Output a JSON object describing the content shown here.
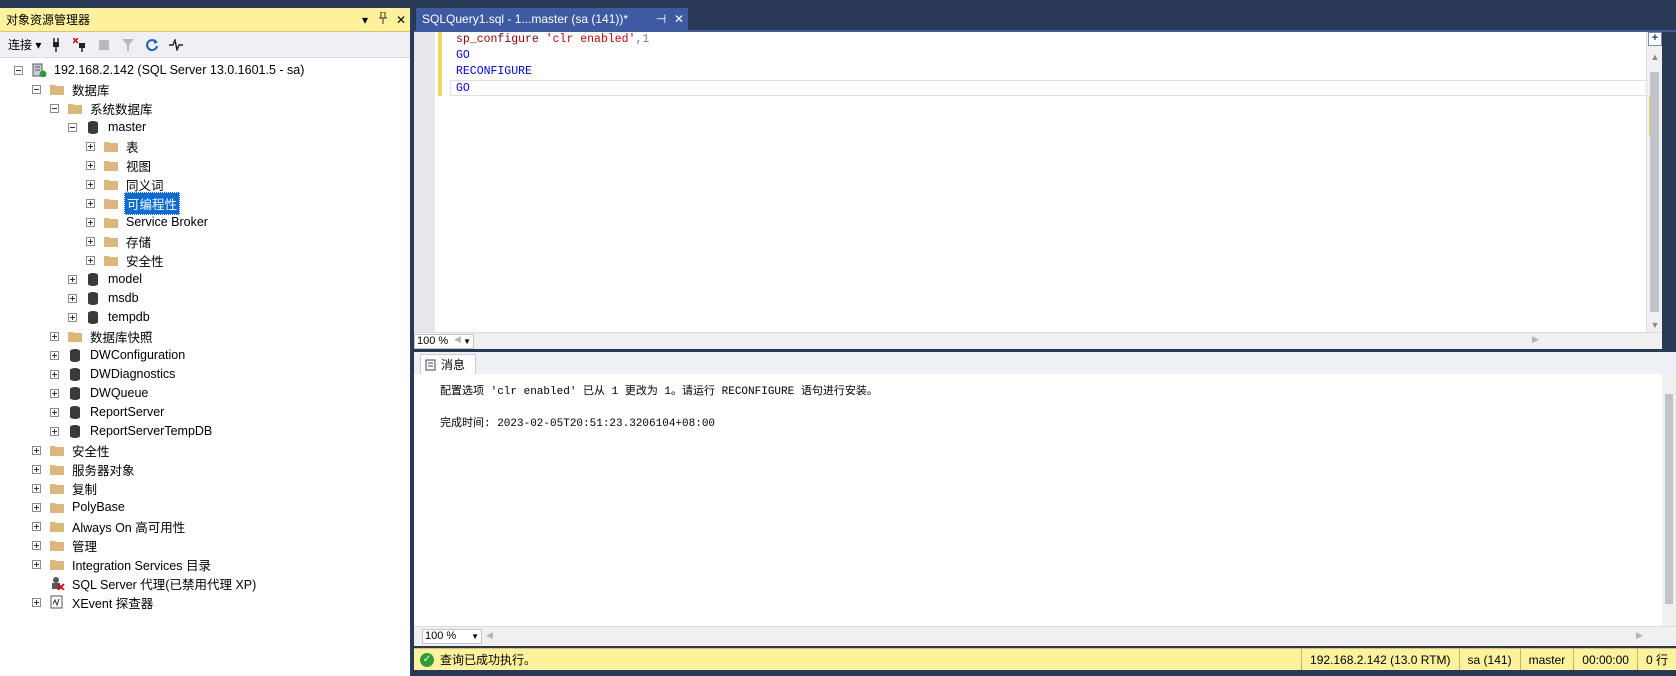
{
  "object_explorer": {
    "title": "对象资源管理器",
    "toolbar": {
      "connect_label": "连接"
    },
    "tree": [
      {
        "id": "server",
        "label": "192.168.2.142 (SQL Server 13.0.1601.5 - sa)",
        "icon": "server-icon"
      },
      {
        "id": "databases",
        "label": "数据库",
        "icon": "folder-icon"
      },
      {
        "id": "system-databases",
        "label": "系统数据库",
        "icon": "folder-icon"
      },
      {
        "id": "master",
        "label": "master",
        "icon": "database-icon"
      },
      {
        "id": "tables",
        "label": "表",
        "icon": "folder-icon"
      },
      {
        "id": "views",
        "label": "视图",
        "icon": "folder-icon"
      },
      {
        "id": "synonyms",
        "label": "同义词",
        "icon": "folder-icon"
      },
      {
        "id": "programmability",
        "label": "可编程性",
        "icon": "folder-icon",
        "selected": true
      },
      {
        "id": "service-broker",
        "label": "Service Broker",
        "icon": "folder-icon"
      },
      {
        "id": "storage",
        "label": "存储",
        "icon": "folder-icon"
      },
      {
        "id": "security-db",
        "label": "安全性",
        "icon": "folder-icon"
      },
      {
        "id": "model",
        "label": "model",
        "icon": "database-icon"
      },
      {
        "id": "msdb",
        "label": "msdb",
        "icon": "database-icon"
      },
      {
        "id": "tempdb",
        "label": "tempdb",
        "icon": "database-icon"
      },
      {
        "id": "snapshots",
        "label": "数据库快照",
        "icon": "folder-icon"
      },
      {
        "id": "dwconfiguration",
        "label": "DWConfiguration",
        "icon": "database-icon"
      },
      {
        "id": "dwdiagnostics",
        "label": "DWDiagnostics",
        "icon": "database-icon"
      },
      {
        "id": "dwqueue",
        "label": "DWQueue",
        "icon": "database-icon"
      },
      {
        "id": "reportserver",
        "label": "ReportServer",
        "icon": "database-icon"
      },
      {
        "id": "reportservertempdb",
        "label": "ReportServerTempDB",
        "icon": "database-icon"
      },
      {
        "id": "security",
        "label": "安全性",
        "icon": "folder-icon"
      },
      {
        "id": "server-objects",
        "label": "服务器对象",
        "icon": "folder-icon"
      },
      {
        "id": "replication",
        "label": "复制",
        "icon": "folder-icon"
      },
      {
        "id": "polybase",
        "label": "PolyBase",
        "icon": "folder-icon"
      },
      {
        "id": "alwayson",
        "label": "Always On 高可用性",
        "icon": "folder-icon"
      },
      {
        "id": "management",
        "label": "管理",
        "icon": "folder-icon"
      },
      {
        "id": "integration-services",
        "label": "Integration Services 目录",
        "icon": "folder-icon"
      },
      {
        "id": "sql-agent",
        "label": "SQL Server 代理(已禁用代理 XP)",
        "icon": "agent-icon"
      },
      {
        "id": "xevent",
        "label": "XEvent 探查器",
        "icon": "xevent-icon"
      }
    ]
  },
  "document_tab": {
    "title": "SQLQuery1.sql - 1...master (sa (141))*"
  },
  "editor": {
    "lines": [
      {
        "fn": "sp_configure",
        "str": "'clr enabled'",
        "rest": ",1"
      },
      {
        "kw": "GO"
      },
      {
        "kw": "RECONFIGURE"
      },
      {
        "kw": "GO"
      }
    ],
    "zoom": "100 %"
  },
  "results": {
    "tab_label": "消息",
    "messages": [
      "配置选项 'clr enabled' 已从 1 更改为 1。请运行 RECONFIGURE 语句进行安装。",
      "完成时间: 2023-02-05T20:51:23.3206104+08:00"
    ],
    "zoom": "100 %"
  },
  "status_bar": {
    "message": "查询已成功执行。",
    "server": "192.168.2.142 (13.0 RTM)",
    "user": "sa (141)",
    "database": "master",
    "elapsed": "00:00:00",
    "rows": "0 行"
  },
  "colors": {
    "title_yellow": "#fff29d",
    "selection_blue": "#0a6bd6",
    "tab_blue": "#3d5aa3",
    "frame_dark": "#293955"
  }
}
